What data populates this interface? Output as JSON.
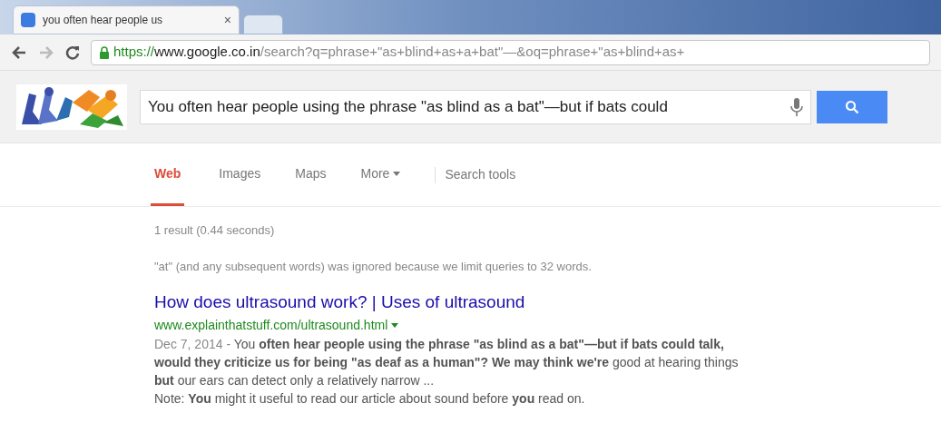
{
  "browser": {
    "tab": {
      "title": "you often hear people us",
      "close": "×"
    },
    "address": {
      "scheme": "https://",
      "host": "www.google.co.in",
      "path": "/search?q=phrase+\"as+blind+as+a+bat\"—&oq=phrase+\"as+blind+as+"
    }
  },
  "search": {
    "query": "You often hear people using the phrase \"as blind as a bat\"—but if bats could"
  },
  "nav": [
    {
      "label": "Web",
      "selected": true,
      "menu": false
    },
    {
      "label": "Images",
      "selected": false,
      "menu": false
    },
    {
      "label": "Maps",
      "selected": false,
      "menu": false
    },
    {
      "label": "More",
      "selected": false,
      "menu": true
    }
  ],
  "search_tools": "Search tools",
  "stats": "1 result (0.44 seconds)",
  "notice": "\"at\" (and any subsequent words) was ignored because we limit queries to 32 words.",
  "results": [
    {
      "title": "How does ultrasound work? | Uses of ultrasound",
      "url": "www.explainthatstuff.com/ultrasound.html",
      "date": "Dec 7, 2014 - ",
      "snippet": "You **often hear people using the phrase \"as blind as a bat\"—but if bats could talk, would they criticize us for being \"as deaf as a human\"? We may think we're** good at hearing things **but** our ears can detect only a relatively narrow ...",
      "note": "Note: **You** might it useful to read our article about sound before **you** read on."
    }
  ]
}
